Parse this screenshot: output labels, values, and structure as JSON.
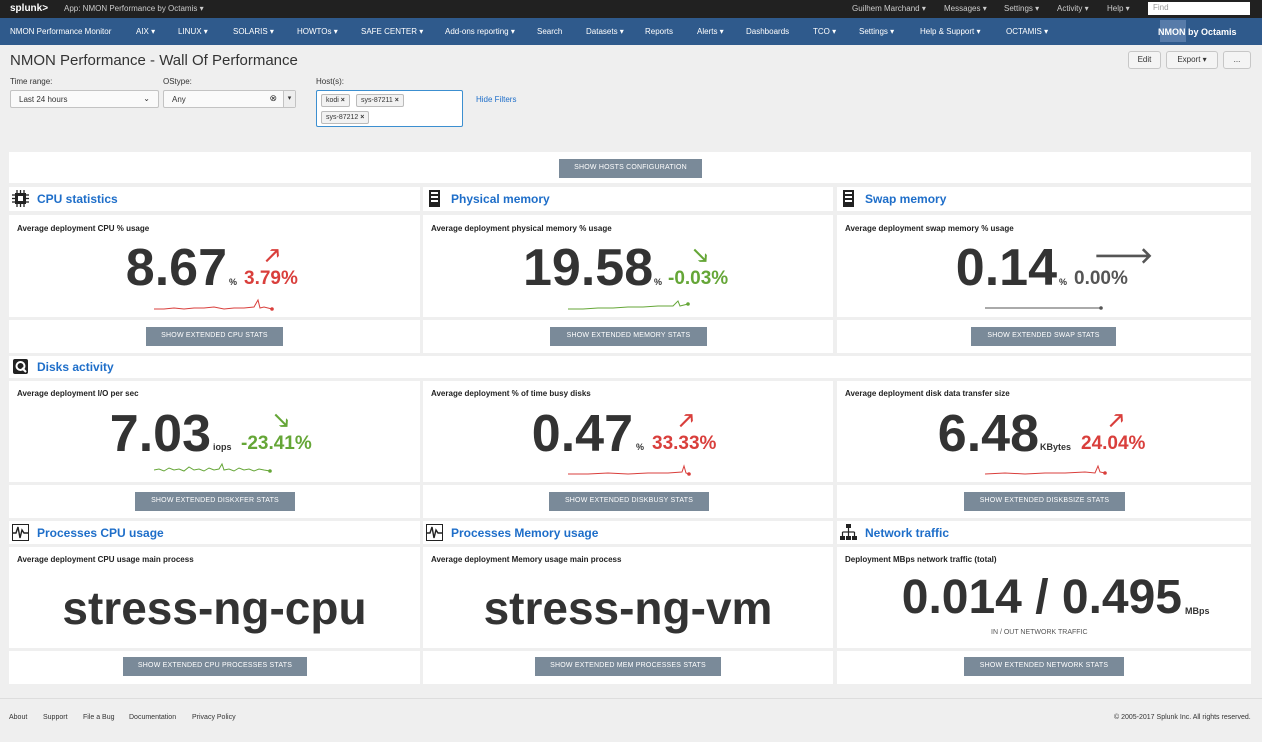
{
  "topbar": {
    "logo": "splunk>",
    "app_selector": "App: NMON Performance by Octamis",
    "user": "Guilhem Marchand",
    "messages": "Messages",
    "settings": "Settings",
    "activity": "Activity",
    "help": "Help",
    "find_placeholder": "Find"
  },
  "nav": {
    "app_name": "NMON Performance Monitor",
    "items": [
      "AIX",
      "LINUX",
      "SOLARIS",
      "HOWTOs",
      "SAFE CENTER",
      "Add-ons reporting",
      "Search",
      "Datasets",
      "Reports",
      "Alerts",
      "Dashboards",
      "TCO",
      "Settings",
      "Help & Support",
      "OCTAMIS"
    ],
    "brand": "NMON by Octamis"
  },
  "dashboard": {
    "title": "NMON Performance - Wall Of Performance",
    "edit": "Edit",
    "export": "Export",
    "more": "..."
  },
  "filters": {
    "time_label": "Time range:",
    "time_value": "Last 24 hours",
    "ostype_label": "OStype:",
    "ostype_value": "Any",
    "hosts_label": "Host(s):",
    "hosts": [
      "kodi",
      "sys-87211",
      "sys-87212"
    ],
    "hide_filters": "Hide Filters"
  },
  "show_hosts_btn": "SHOW HOSTS CONFIGURATION",
  "sections": {
    "cpu": "CPU statistics",
    "memory": "Physical memory",
    "swap": "Swap memory",
    "disks": "Disks activity",
    "proc_cpu": "Processes CPU usage",
    "proc_mem": "Processes Memory usage",
    "network": "Network traffic"
  },
  "metrics": {
    "cpu": {
      "label": "Average deployment CPU % usage",
      "value": "8.67",
      "unit": "%",
      "trend": "3.79%",
      "direction": "up",
      "color": "#d93f3c",
      "button": "SHOW EXTENDED CPU STATS"
    },
    "memory": {
      "label": "Average deployment physical memory % usage",
      "value": "19.58",
      "unit": "%",
      "trend": "-0.03%",
      "direction": "down",
      "color": "#65a637",
      "button": "SHOW EXTENDED MEMORY STATS"
    },
    "swap": {
      "label": "Average deployment swap memory % usage",
      "value": "0.14",
      "unit": "%",
      "trend": "0.00%",
      "direction": "flat",
      "color": "#555555",
      "button": "SHOW EXTENDED SWAP STATS"
    },
    "diskxfer": {
      "label": "Average deployment I/O per sec",
      "value": "7.03",
      "unit": "iops",
      "trend": "-23.41%",
      "direction": "down",
      "color": "#65a637",
      "button": "SHOW EXTENDED DISKXFER STATS"
    },
    "diskbusy": {
      "label": "Average deployment % of time busy disks",
      "value": "0.47",
      "unit": "%",
      "trend": "33.33%",
      "direction": "up",
      "color": "#d93f3c",
      "button": "SHOW EXTENDED DISKBUSY STATS"
    },
    "diskbsize": {
      "label": "Average deployment disk data transfer size",
      "value": "6.48",
      "unit": "KBytes",
      "trend": "24.04%",
      "direction": "up",
      "color": "#d93f3c",
      "button": "SHOW EXTENDED DISKBSIZE STATS"
    },
    "proc_cpu": {
      "label": "Average deployment CPU usage main process",
      "value": "stress-ng-cpu",
      "button": "SHOW EXTENDED CPU PROCESSES STATS"
    },
    "proc_mem": {
      "label": "Average deployment Memory usage main process",
      "value": "stress-ng-vm",
      "button": "SHOW EXTENDED MEM PROCESSES STATS"
    },
    "network": {
      "label": "Deployment MBps network traffic (total)",
      "value": "0.014 / 0.495",
      "unit": "MBps",
      "caption": "IN / OUT NETWORK TRAFFIC",
      "button": "SHOW EXTENDED NETWORK STATS"
    }
  },
  "footer": {
    "links": [
      "About",
      "Support",
      "File a Bug",
      "Documentation",
      "Privacy Policy"
    ],
    "copyright": "© 2005-2017 Splunk Inc. All rights reserved."
  }
}
